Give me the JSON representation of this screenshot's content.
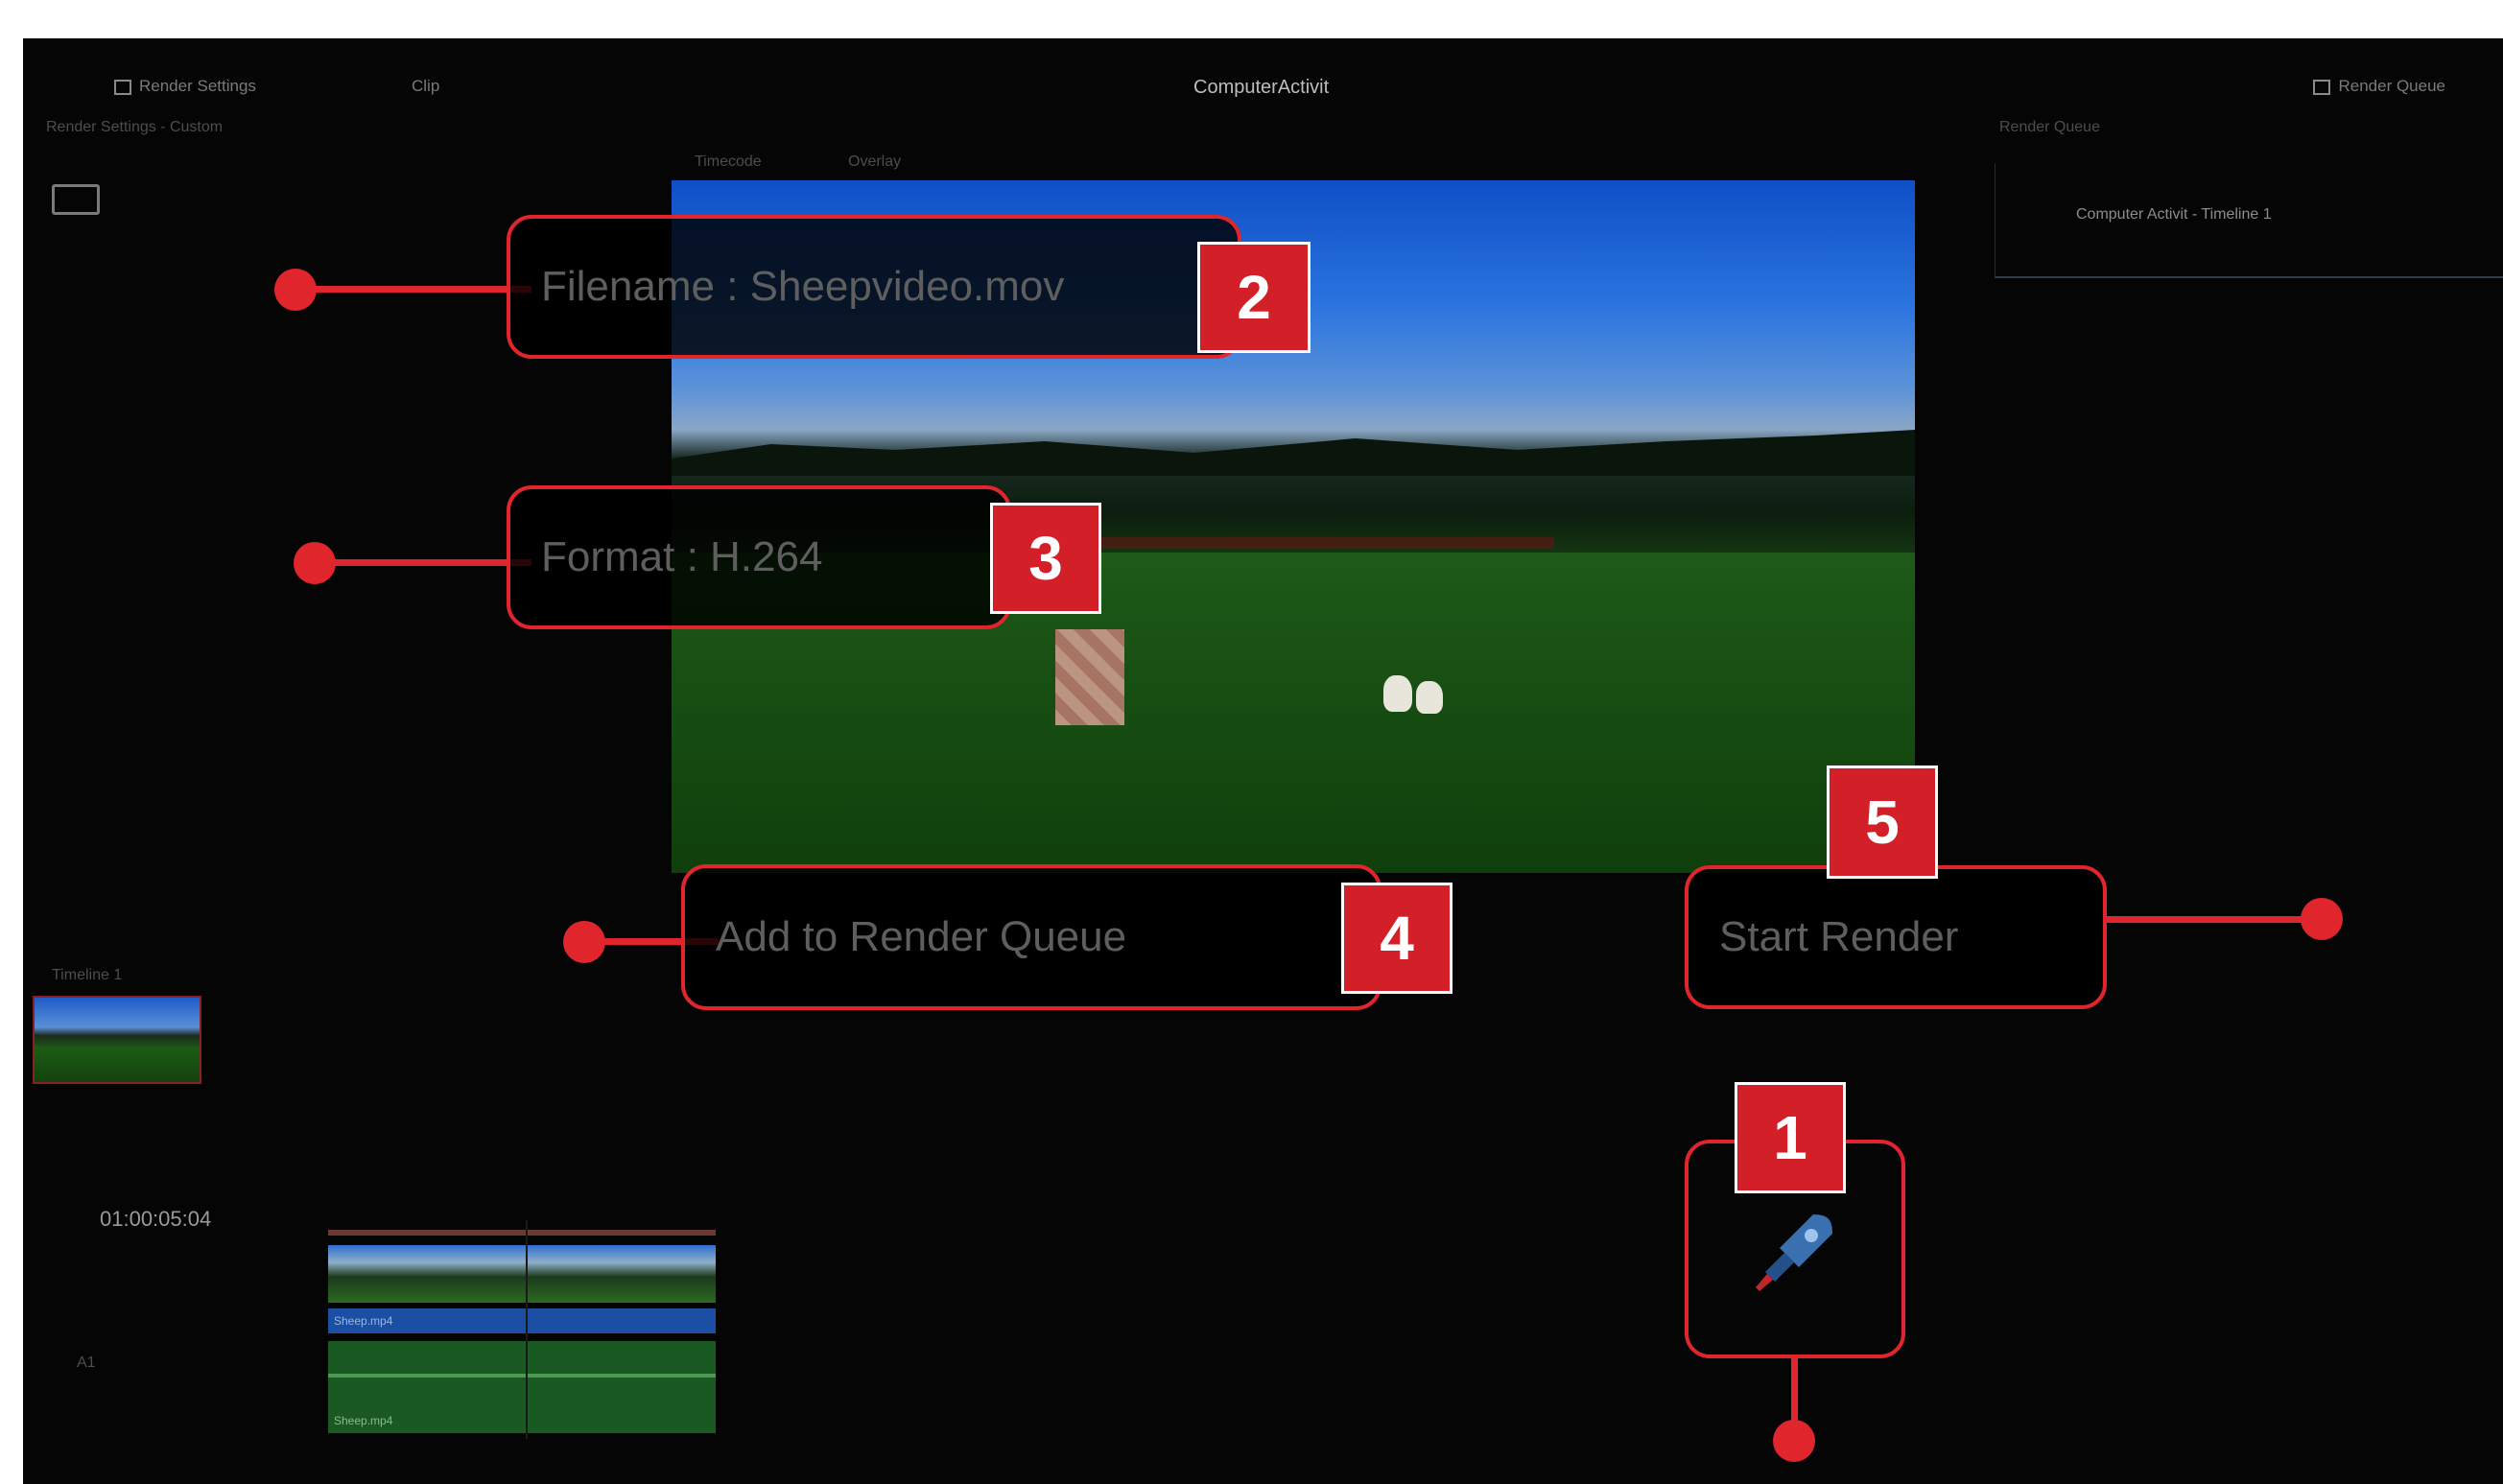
{
  "app": {
    "title": "ComputerActivit",
    "top_left_1": "Render Settings",
    "top_left_2": "Clip",
    "top_right": "Render Queue",
    "settings_label": "Render Settings - Custom",
    "viewer_label_1": "Timecode",
    "viewer_label_2": "Overlay"
  },
  "queue": {
    "header": "Render Queue",
    "job": "Computer Activit - Timeline 1"
  },
  "media": {
    "thumb_label": "Timeline 1",
    "timecode": "01:00:05:04",
    "track_label": "A1",
    "video_clip": "Sheep.mp4",
    "audio_clip": "Sheep.mp4"
  },
  "callouts": {
    "filename": "Filename : Sheepvideo.mov",
    "format": "Format : H.264",
    "add_queue": "Add to Render Queue",
    "start_render": "Start Render",
    "n1": "1",
    "n2": "2",
    "n3": "3",
    "n4": "4",
    "n5": "5"
  },
  "colors": {
    "callout_red": "#e0252d",
    "badge_red": "#d31f27"
  },
  "icons": {
    "render_button": "rocket-icon"
  }
}
